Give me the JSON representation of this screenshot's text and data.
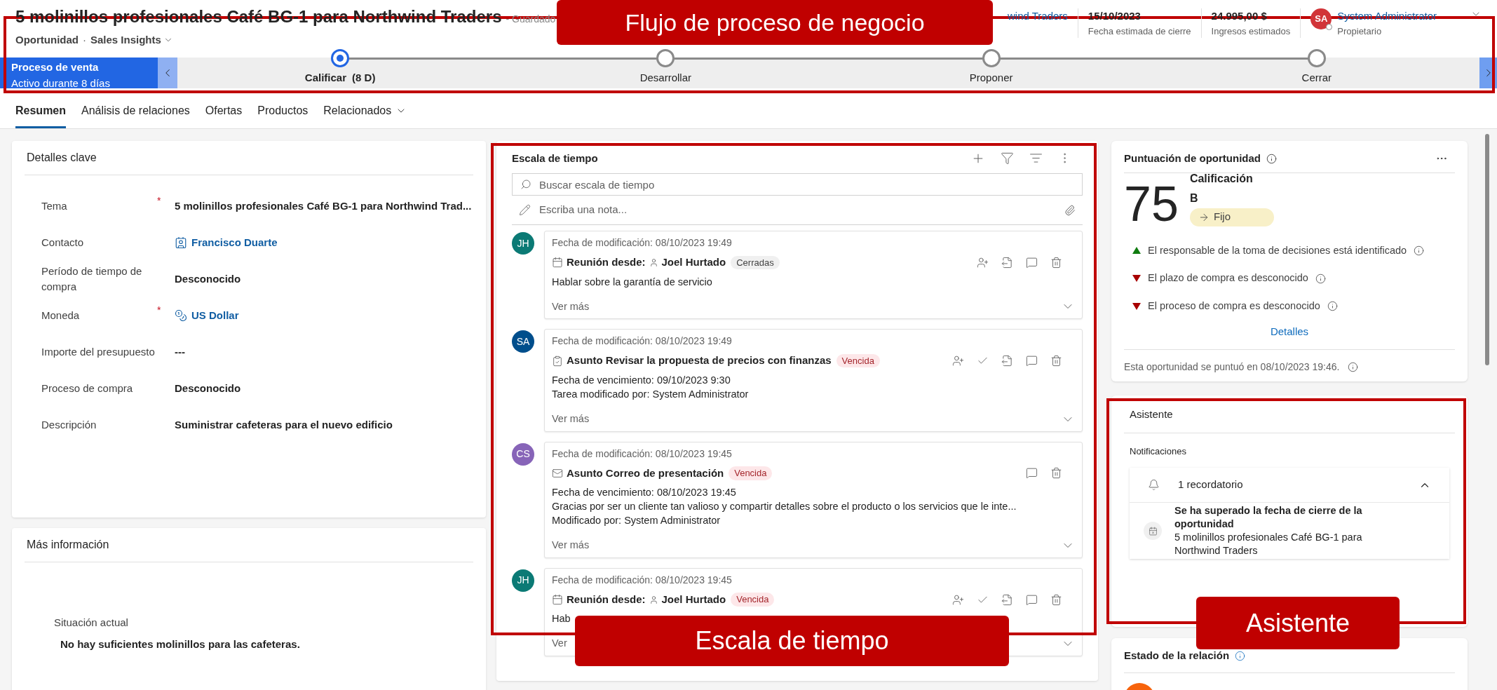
{
  "header": {
    "title": "5 molinillos profesionales Café BG-1 para Northwind Traders",
    "save_status": "- Guardado",
    "entity": "Oportunidad",
    "separator": "·",
    "form": "Sales Insights",
    "account": "wind Traders",
    "fields": [
      {
        "value": "15/10/2023",
        "label": "Fecha estimada de cierre"
      },
      {
        "value": "24.995,00 $",
        "label": "Ingresos estimados"
      }
    ],
    "owner": {
      "initials": "SA",
      "name": "System Administrator",
      "role": "Propietario"
    }
  },
  "process": {
    "name": "Proceso de venta",
    "duration": "Activo durante 8 días",
    "stages": [
      {
        "label": "Calificar",
        "days": "(8 D)",
        "selected": true
      },
      {
        "label": "Desarrollar",
        "selected": false
      },
      {
        "label": "Proponer",
        "selected": false
      },
      {
        "label": "Cerrar",
        "selected": false
      }
    ]
  },
  "tabs": [
    {
      "label": "Resumen",
      "selected": true,
      "menu": false
    },
    {
      "label": "Análisis de relaciones",
      "selected": false,
      "menu": false
    },
    {
      "label": "Ofertas",
      "selected": false,
      "menu": false
    },
    {
      "label": "Productos",
      "selected": false,
      "menu": false
    },
    {
      "label": "Relacionados",
      "selected": false,
      "menu": true
    }
  ],
  "key_details": {
    "title": "Detalles clave",
    "fields": [
      {
        "label": "Tema",
        "required_mark": "*",
        "value": "5 molinillos profesionales Café BG-1 para Northwind Trad...",
        "kind": "text"
      },
      {
        "label": "Contacto",
        "value": "Francisco Duarte",
        "kind": "contact"
      },
      {
        "label": "Período de tiempo de compra",
        "value": "Desconocido",
        "kind": "text"
      },
      {
        "label": "Moneda",
        "required_mark": "*",
        "value": "US Dollar",
        "kind": "currency"
      },
      {
        "label": "Importe del presupuesto",
        "value": "---",
        "kind": "text"
      },
      {
        "label": "Proceso de compra",
        "value": "Desconocido",
        "kind": "text"
      },
      {
        "label": "Descripción",
        "value": "Suministrar cafeteras para el nuevo edificio",
        "kind": "text"
      }
    ]
  },
  "more_info": {
    "title": "Más información",
    "label": "Situación actual",
    "value": "No hay suficientes molinillos para las cafeteras."
  },
  "timeline": {
    "title": "Escala de tiempo",
    "search_placeholder": "Buscar escala de tiempo",
    "note_placeholder": "Escriba una nota...",
    "items": [
      {
        "initials": "JH",
        "color": "#0b7a75",
        "modified": "Fecha de modificación: 08/10/2023 19:49",
        "kind": "meeting",
        "subject_prefix": "Reunión desde:",
        "person": "Joel Hurtado",
        "badge": {
          "text": "Cerradas",
          "kind": "closed"
        },
        "lines": [
          "Hablar sobre la garantía de servicio"
        ],
        "more": "Ver más",
        "actions": [
          {
            "kind": "assign"
          },
          {
            "kind": "open"
          },
          {
            "kind": "comment"
          },
          {
            "kind": "delete"
          }
        ]
      },
      {
        "initials": "SA",
        "color": "#004e8c",
        "modified": "Fecha de modificación: 08/10/2023 19:49",
        "kind": "task",
        "subject": "Asunto Revisar la propuesta de precios con finanzas",
        "badge": {
          "text": "Vencida",
          "kind": "overdue"
        },
        "lines": [
          "Fecha de vencimiento: 09/10/2023 9:30",
          "Tarea modificado por: System Administrator"
        ],
        "more": "Ver más",
        "actions": [
          {
            "kind": "assign"
          },
          {
            "kind": "complete"
          },
          {
            "kind": "open"
          },
          {
            "kind": "comment"
          },
          {
            "kind": "delete"
          }
        ]
      },
      {
        "initials": "CS",
        "color": "#8764b8",
        "modified": "Fecha de modificación: 08/10/2023 19:45",
        "kind": "email",
        "subject": "Asunto Correo de presentación",
        "badge": {
          "text": "Vencida",
          "kind": "overdue"
        },
        "lines": [
          "Fecha de vencimiento: 08/10/2023 19:45",
          "Gracias por ser un cliente tan valioso y compartir detalles sobre el producto o los servicios que le inte...",
          "Modificado por: System Administrator"
        ],
        "more": "Ver más",
        "actions": [
          {
            "kind": "comment"
          },
          {
            "kind": "delete"
          }
        ]
      },
      {
        "initials": "JH",
        "color": "#0b7a75",
        "modified": "Fecha de modificación: 08/10/2023 19:45",
        "kind": "meeting",
        "subject_prefix": "Reunión desde:",
        "person": "Joel Hurtado",
        "badge": {
          "text": "Vencida",
          "kind": "overdue"
        },
        "lines": [
          "Hab"
        ],
        "more": "Ver",
        "actions": [
          {
            "kind": "assign"
          },
          {
            "kind": "complete"
          },
          {
            "kind": "open"
          },
          {
            "kind": "comment"
          },
          {
            "kind": "delete"
          }
        ]
      }
    ]
  },
  "score": {
    "title": "Puntuación de oportunidad",
    "value": "75",
    "grade_label": "Calificación",
    "grade": "B",
    "trend": "Fijo",
    "factors": [
      {
        "text": "El responsable de la toma de decisiones está identificado",
        "kind": "up"
      },
      {
        "text": "El plazo de compra es desconocido",
        "kind": "down"
      },
      {
        "text": "El proceso de compra es desconocido",
        "kind": "down"
      }
    ],
    "details_link": "Detalles",
    "footer": "Esta oportunidad se puntuó en 08/10/2023 19:46."
  },
  "assistant": {
    "title": "Asistente",
    "section": "Notificaciones",
    "group": "1 recordatorio",
    "expanded": true,
    "cards": [
      {
        "title": "Se ha superado la fecha de cierre de la oportunidad",
        "body": "5 molinillos profesionales Café BG-1 para Northwind Traders"
      }
    ]
  },
  "relationship": {
    "title": "Estado de la relación"
  },
  "callouts": [
    {
      "text": "Flujo de proceso de negocio",
      "kind": "process"
    },
    {
      "text": "Escala de tiempo",
      "kind": "timeline"
    },
    {
      "text": "Asistente",
      "kind": "assistant"
    }
  ]
}
